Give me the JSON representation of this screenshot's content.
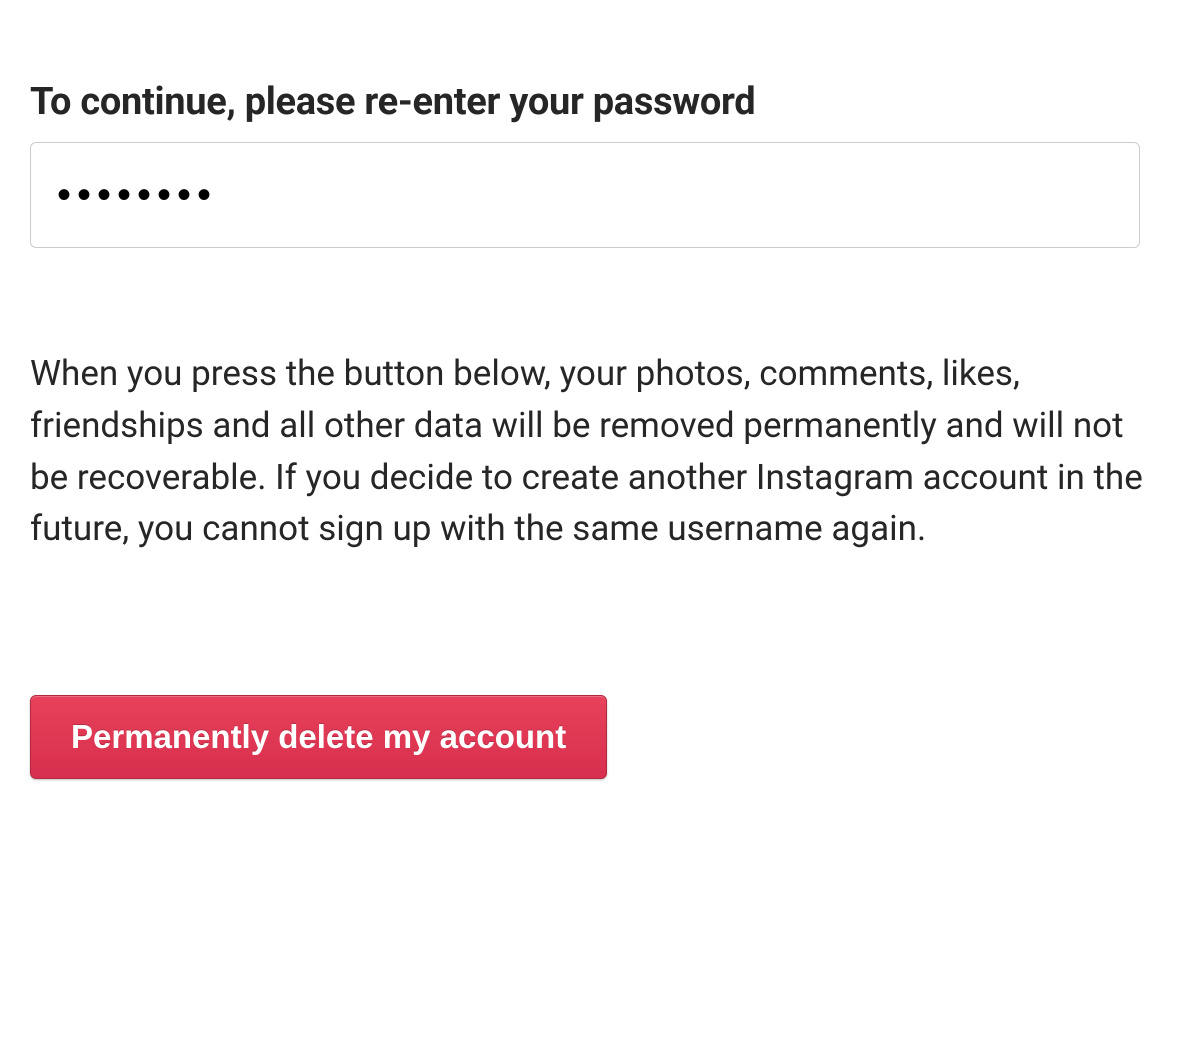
{
  "form": {
    "password_label": "To continue, please re-enter your password",
    "password_value": "••••••••",
    "warning_text": "When you press the button below, your photos, comments, likes, friendships and all other data will be removed permanently and will not be recoverable. If you decide to create another Instagram account in the future, you cannot sign up with the same username again.",
    "delete_button_label": "Permanently delete my account"
  }
}
